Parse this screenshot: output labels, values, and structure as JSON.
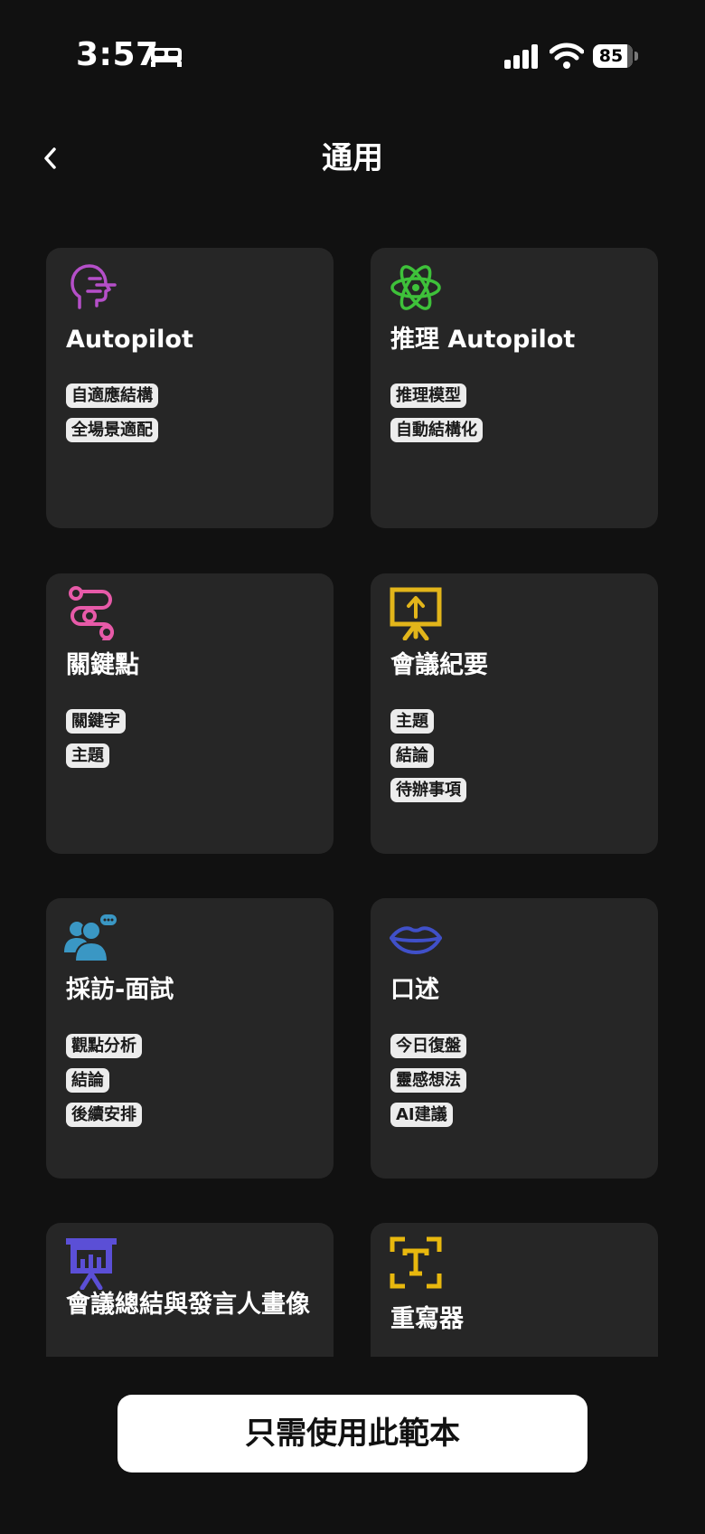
{
  "status_bar": {
    "time": "3:57",
    "battery": "85"
  },
  "header": {
    "title": "通用"
  },
  "cards": [
    {
      "title": "Autopilot",
      "icon": "head-speaking-icon",
      "color": "#b54fc9",
      "tags": [
        "自適應結構",
        "全場景適配"
      ]
    },
    {
      "title": "推理 Autopilot",
      "icon": "atom-icon",
      "color": "#3ec13a",
      "tags": [
        "推理模型",
        "自動結構化"
      ]
    },
    {
      "title": "關鍵點",
      "icon": "route-path-icon",
      "color": "#e75aa8",
      "tags": [
        "關鍵字",
        "主題"
      ]
    },
    {
      "title": "會議紀要",
      "icon": "presentation-board-icon",
      "color": "#e2b51a",
      "tags": [
        "主題",
        "結論",
        "待辦事項"
      ]
    },
    {
      "title": "採訪-面試",
      "icon": "interview-people-icon",
      "color": "#3a97c4",
      "tags": [
        "觀點分析",
        "結論",
        "後續安排"
      ]
    },
    {
      "title": "口述",
      "icon": "lips-icon",
      "color": "#4050c9",
      "tags": [
        "今日復盤",
        "靈感想法",
        "AI建議"
      ]
    },
    {
      "title": "會議總結與發言人畫像",
      "icon": "chart-presentation-icon",
      "color": "#5b4fd6",
      "tags": []
    },
    {
      "title": "重寫器",
      "icon": "text-scan-icon",
      "color": "#e8b80e",
      "tags": []
    }
  ],
  "cta": {
    "label": "只需使用此範本"
  }
}
